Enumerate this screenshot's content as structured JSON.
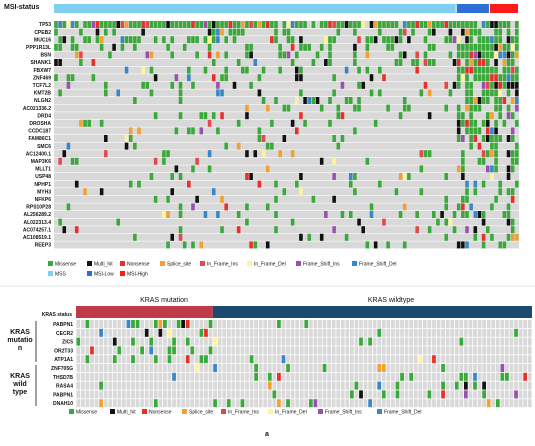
{
  "chart_data": [
    {
      "type": "heatmap",
      "title": "MSI-status",
      "groups": [
        {
          "name": "MSS",
          "count": 97,
          "color": "#7fd0f0"
        },
        {
          "name": "MSI-Low",
          "count": 8,
          "color": "#2e6fd6"
        },
        {
          "name": "MSI-High",
          "count": 7,
          "color": "#ff1a1a"
        }
      ],
      "genes": [
        "TP53",
        "CPEB2",
        "MUC16",
        "PPP1R13L",
        "BSN",
        "SHANK1",
        "FBXW7",
        "ZNF469",
        "TCF7L2",
        "KMT2B",
        "NLGN2",
        "AC021336.2",
        "DRD4",
        "DROSHA",
        "CCDC187",
        "FAM86C1",
        "SMC6",
        "AC12400.1",
        "MAP3K6",
        "MLLT1",
        "USP48",
        "NPHP1",
        "MYH3",
        "NFKP6",
        "RPS10P28",
        "AL256289.2",
        "AL022313.4",
        "AC074257.1",
        "AC108519.1",
        "REEP3"
      ],
      "mutation_types": [
        {
          "name": "Missense",
          "color": "#3aa83a"
        },
        {
          "name": "Multi_hit",
          "color": "#111111"
        },
        {
          "name": "Nonsense",
          "color": "#e8302a"
        },
        {
          "name": "Splice_site",
          "color": "#f2a032"
        },
        {
          "name": "In_Frame_Ins",
          "color": "#e04a4a"
        },
        {
          "name": "In_Frame_Del",
          "color": "#fff39a"
        },
        {
          "name": "Frame_Shift_Ins",
          "color": "#9b50b0"
        },
        {
          "name": "Frame_Shift_Del",
          "color": "#3a87c8"
        }
      ],
      "legend_groups": [
        {
          "name": "MSS",
          "color": "#7fd0f0"
        },
        {
          "name": "MSI-Low",
          "color": "#2e6fd6"
        },
        {
          "name": "MSI-High",
          "color": "#ff1a1a"
        }
      ],
      "n_samples": 112
    },
    {
      "type": "heatmap",
      "status_label": "KRAS status",
      "groups": [
        {
          "name": "KRAS mutation",
          "count": 30,
          "color": "#c03a48"
        },
        {
          "name": "KRAS wildtype",
          "count": 70,
          "color": "#1c4a6e"
        }
      ],
      "row_groups": [
        {
          "label": "KRAS mutation",
          "rows": [
            "PABPN1",
            "CECR2",
            "ZIC5",
            "OR2T33",
            "ATP1A1"
          ]
        },
        {
          "label": "KRAS wild type",
          "rows": [
            "ZNF705G",
            "THSD7B",
            "RASA4",
            "PABPN1",
            "DNAH10"
          ]
        }
      ],
      "genes": [
        "PABPN1",
        "CECR2",
        "ZIC5",
        "OR2T33",
        "ATP1A1",
        "ZNF705G",
        "THSD7B",
        "RASA4",
        "PABPN1",
        "DNAH10"
      ],
      "mutation_types": [
        {
          "name": "Missense",
          "color": "#3aa83a"
        },
        {
          "name": "Multi_hit",
          "color": "#111111"
        },
        {
          "name": "Nonsense",
          "color": "#e8302a"
        },
        {
          "name": "Splice_site",
          "color": "#f2a032"
        },
        {
          "name": "In_Frame_Ins",
          "color": "#e04a4a"
        },
        {
          "name": "In_Frame_Del",
          "color": "#fff39a"
        },
        {
          "name": "Frame_Shift_Ins",
          "color": "#9b50b0"
        },
        {
          "name": "Frame_Shift_Del",
          "color": "#3a87c8"
        }
      ],
      "n_samples": 100
    }
  ],
  "caption": "a"
}
